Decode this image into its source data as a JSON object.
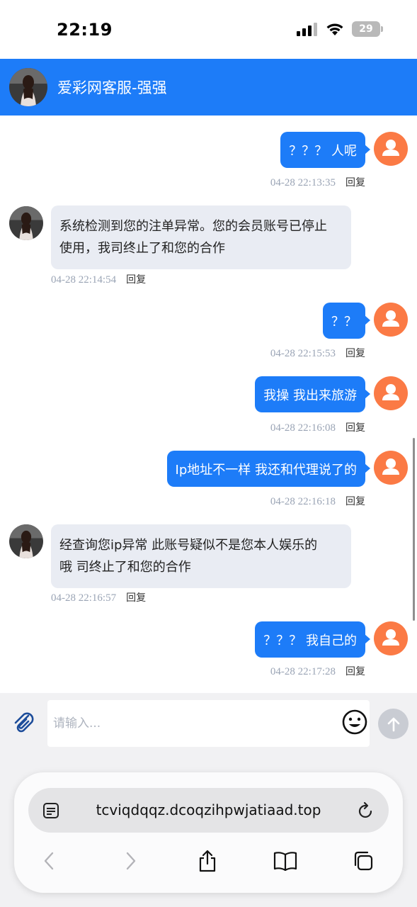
{
  "status_bar": {
    "time": "22:19",
    "battery": "29"
  },
  "header": {
    "title": "爱彩网客服-强强"
  },
  "messages": [
    {
      "side": "right",
      "text": "？？？ 人呢",
      "time": "04-28 22:13:35",
      "reply": "回复"
    },
    {
      "side": "left",
      "lines": [
        "系统检测到您的注单异常。您的会员账号已停止",
        "使用，我司终止了和您的合作"
      ],
      "time": "04-28 22:14:54",
      "reply": "回复"
    },
    {
      "side": "right",
      "text": "？？",
      "time": "04-28 22:15:53",
      "reply": "回复"
    },
    {
      "side": "right",
      "text": "我操 我出来旅游",
      "time": "04-28 22:16:08",
      "reply": "回复"
    },
    {
      "side": "right",
      "text": "Ip地址不一样 我还和代理说了的",
      "time": "04-28 22:16:18",
      "reply": "回复"
    },
    {
      "side": "left",
      "lines": [
        "经查询您ip异常 此账号疑似不是您本人娱乐的",
        "哦 司终止了和您的合作"
      ],
      "time": "04-28 22:16:57",
      "reply": "回复"
    },
    {
      "side": "right",
      "text": "？？？ 我自己的",
      "time": "04-28 22:17:28",
      "reply": "回复"
    }
  ],
  "input": {
    "placeholder": "请输入..."
  },
  "browser": {
    "url": "tcviqdqqz.dcoqzihpwjatiaad.top"
  },
  "colors": {
    "accent": "#1d7cf8",
    "user_avatar": "#fb7a45",
    "agent_bubble": "#e9ecf3"
  }
}
